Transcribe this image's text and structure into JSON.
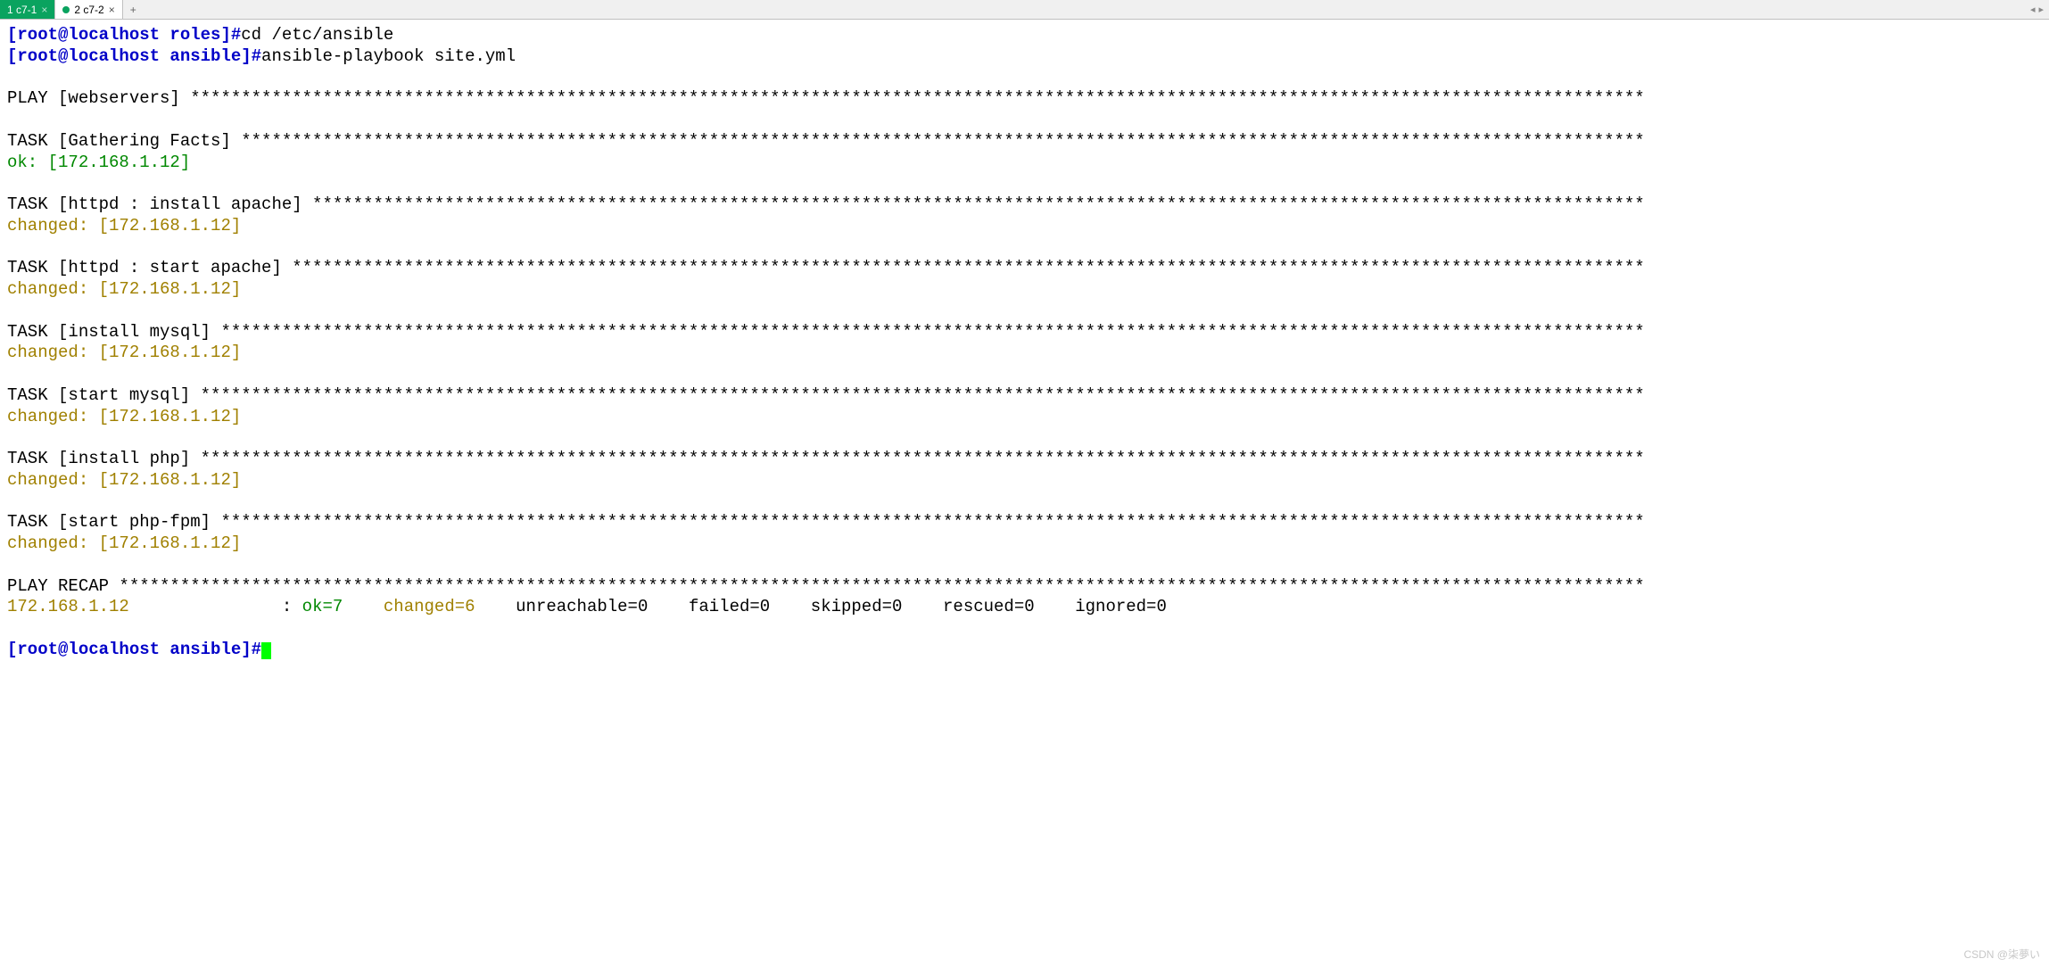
{
  "tabs": [
    {
      "label": "1 c7-1",
      "active": true
    },
    {
      "label": "2 c7-2",
      "active": false
    }
  ],
  "prompt1_user": "[root@localhost roles]#",
  "cmd1": "cd /etc/ansible",
  "prompt2_user": "[root@localhost ansible]#",
  "cmd2": "ansible-playbook site.yml",
  "play_header": "PLAY [webservers] ***********************************************************************************************************************************************",
  "task_gather": "TASK [Gathering Facts] ******************************************************************************************************************************************",
  "ok_line": "ok: [172.168.1.12]",
  "task_install_apache": "TASK [httpd : install apache] ***********************************************************************************************************************************",
  "changed_line": "changed: [172.168.1.12]",
  "task_start_apache": "TASK [httpd : start apache] *************************************************************************************************************************************",
  "task_install_mysql": "TASK [install mysql] ********************************************************************************************************************************************",
  "task_start_mysql": "TASK [start mysql] **********************************************************************************************************************************************",
  "task_install_php": "TASK [install php] **********************************************************************************************************************************************",
  "task_start_phpfpm": "TASK [start php-fpm] ********************************************************************************************************************************************",
  "play_recap": "PLAY RECAP ******************************************************************************************************************************************************",
  "recap_host": "172.168.1.12",
  "recap_colon": "               : ",
  "recap_ok": "ok=7   ",
  "recap_changed": "changed=6   ",
  "recap_rest": "unreachable=0    failed=0    skipped=0    rescued=0    ignored=0",
  "prompt_final": "[root@localhost ansible]#",
  "watermark": "CSDN @柒夢い"
}
